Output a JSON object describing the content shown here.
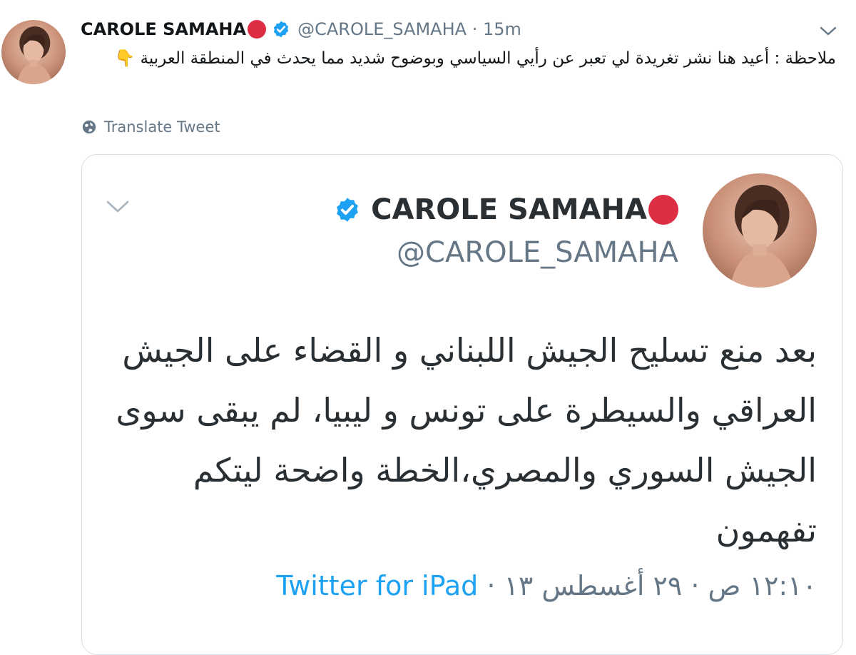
{
  "outer_tweet": {
    "display_name": "CAROLE SAMAHA",
    "handle": "@CAROLE_SAMAHA",
    "separator": "·",
    "time": "15m",
    "text": "ملاحظة : أعيد هنا نشر تغريدة لي تعبر عن رأيي السياسي وبوضوح شديد مما يحدث في المنطقة العربية 👇",
    "translate_label": "Translate Tweet"
  },
  "quoted_tweet": {
    "display_name": "CAROLE SAMAHA",
    "handle": "@CAROLE_SAMAHA",
    "text": "بعد منع تسليح الجيش اللبناني و القضاء على الجيش العراقي والسيطرة على تونس و ليبيا، لم يبقى سوى الجيش السوري والمصري،الخطة واضحة ليتكم تفهمون",
    "timestamp": "١٢:١٠ ص · ٢٩ أغسطس ١٣",
    "separator": "·",
    "source": "Twitter for iPad"
  },
  "colors": {
    "accent": "#1da1f2",
    "red_dot": "#dd2e44",
    "muted": "#657786",
    "text": "#14171a"
  },
  "icons": [
    "avatar-photo",
    "red-circle-emoji",
    "verified-badge-icon",
    "chevron-down-icon",
    "globe-icon"
  ]
}
